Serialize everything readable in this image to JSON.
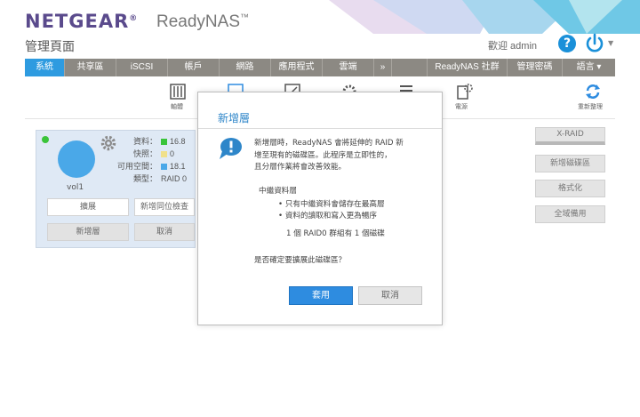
{
  "header": {
    "brand": "NETGEAR",
    "brand_reg": "®",
    "product": "ReadyNAS",
    "product_tm": "™",
    "page_title": "管理頁面",
    "welcome": "歡迎 admin",
    "help_label": "?"
  },
  "nav": {
    "items": [
      {
        "label": "系統"
      },
      {
        "label": "共享區"
      },
      {
        "label": "iSCSI"
      },
      {
        "label": "帳戶"
      },
      {
        "label": "網路"
      },
      {
        "label": "應用程式"
      },
      {
        "label": "雲端"
      },
      {
        "label": "»"
      },
      {
        "label": ""
      },
      {
        "label": "ReadyNAS 社群"
      },
      {
        "label": "管理密碼"
      },
      {
        "label": "語言 ▾"
      }
    ]
  },
  "toolbar": {
    "overview_label": "軸體",
    "power_label": "電源",
    "refresh_label": "重新整理"
  },
  "volume": {
    "name": "vol1",
    "stats": [
      {
        "key": "資料：",
        "value": "16.8",
        "color": "#3ac43a"
      },
      {
        "key": "快照：",
        "value": "0",
        "color": "#f0e08a"
      },
      {
        "key": "可用空間：",
        "value": "18.1",
        "color": "#4aa8e8"
      },
      {
        "key": "類型：",
        "value": "RAID 0",
        "color": ""
      }
    ],
    "expand_label": "擴展",
    "add_parity_label": "新增同位檢查",
    "add_tier_label": "新增層",
    "cancel_label": "取消"
  },
  "right_panel": {
    "xraid_label": "X-RAID",
    "new_volume_label": "新增磁碟區",
    "format_label": "格式化",
    "global_spare_label": "全域備用"
  },
  "dialog": {
    "title": "新增層",
    "line1": "新增層時，ReadyNAS 會將延伸的 RAID 新",
    "line2": "增至現有的磁碟區。此程序是立即性的，",
    "line3": "且分層作業將會改善效能。",
    "section_title": "中繼資料層",
    "bullet1": "只有中繼資料會儲存在最高層",
    "bullet2": "資料的讀取和寫入更為暢序",
    "raid_info": "1 個 RAID0 群組有 1 個磁碟",
    "confirm": "是否確定要擴展此磁碟區？",
    "apply_label": "套用",
    "cancel_label": "取消"
  },
  "colors": {
    "brand": "#5a4a8c",
    "accent": "#2e9be0",
    "nav_bg": "#8c8983",
    "volume_card": "#dfe9f5"
  }
}
